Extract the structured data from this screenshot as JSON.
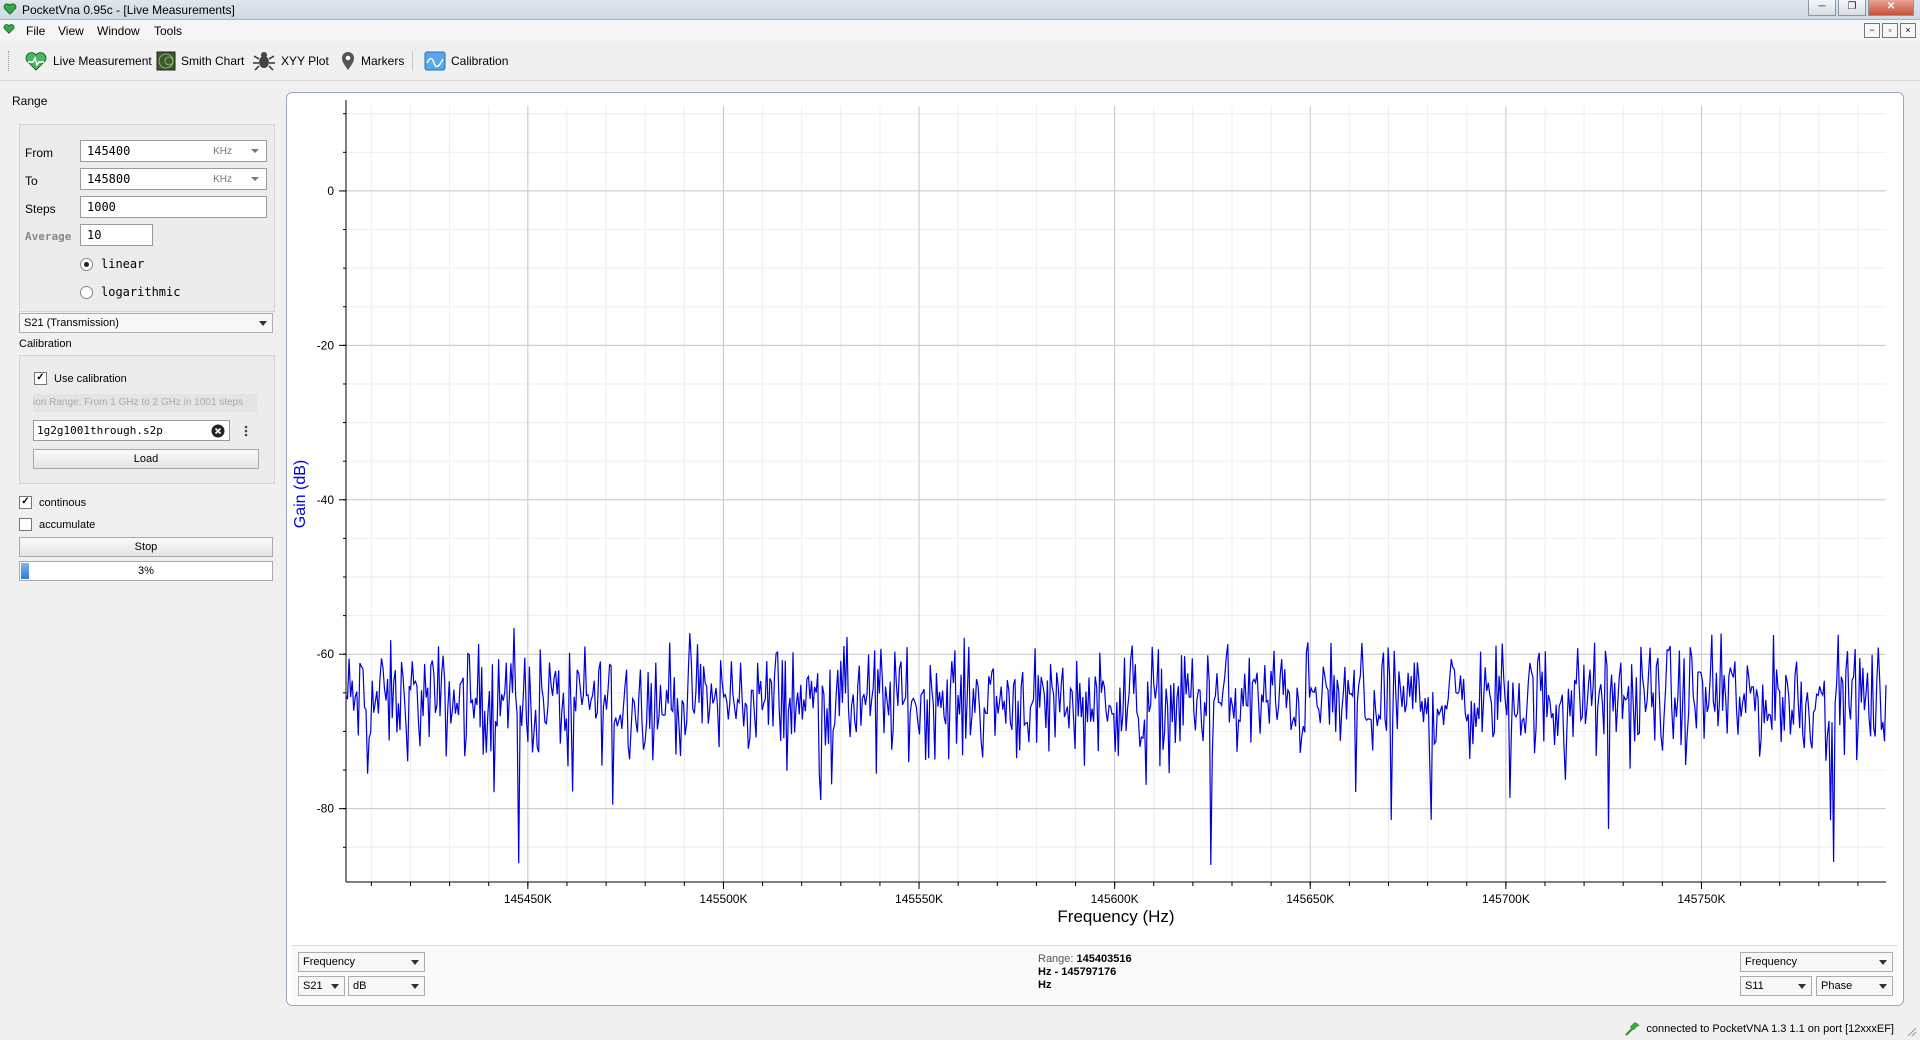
{
  "window": {
    "title": "PocketVna 0.95c - [Live Measurements]",
    "controls": [
      "─",
      "❐",
      "✕"
    ]
  },
  "menu": [
    "File",
    "View",
    "Window",
    "Tools"
  ],
  "mdi_controls": [
    "−",
    "▫",
    "×"
  ],
  "toolbar": [
    {
      "label": "Live Measurement",
      "icon": "heart-monitor-icon"
    },
    {
      "label": "Smith Chart",
      "icon": "smith-chart-icon"
    },
    {
      "label": "XYY Plot",
      "icon": "bug-plot-icon"
    },
    {
      "label": "Markers",
      "icon": "map-marker-icon"
    },
    {
      "label": "Calibration",
      "icon": "calibration-icon"
    }
  ],
  "range": {
    "title": "Range",
    "from_label": "From",
    "from_value": "145400",
    "from_unit": "KHz",
    "to_label": "To",
    "to_value": "145800",
    "to_unit": "KHz",
    "steps_label": "Steps",
    "steps_value": "1000",
    "average_label": "Average",
    "average_value": "10",
    "linear_label": "linear",
    "log_label": "logarithmic",
    "scale_selected": "linear"
  },
  "sparam_select": "S21 (Transmission)",
  "calibration": {
    "title": "Calibration",
    "use_label": "Use calibration",
    "use_checked": true,
    "range_info": "ion Range: From 1 GHz to 2 GHz in 1001 steps",
    "file": "1g2g1001through.s2p",
    "load_label": "Load"
  },
  "continuous": {
    "label": "continous",
    "checked": true
  },
  "accumulate": {
    "label": "accumulate",
    "checked": false
  },
  "stop_label": "Stop",
  "progress": {
    "percent": 3,
    "text": "3%"
  },
  "plot_bottom": {
    "left_axis_select": "Frequency",
    "left_param": "S21",
    "left_unit": "dB",
    "range_label": "Range:",
    "range_start": "145403516",
    "range_mid": "Hz - 145797176",
    "range_end": "Hz",
    "right_axis_select": "Frequency",
    "right_param": "S11",
    "right_unit": "Phase"
  },
  "status": {
    "text": "connected to PocketVNA 1.3 1.1 on port [12xxxEF]"
  },
  "chart_data": {
    "type": "line",
    "xlabel": "Frequency (Hz)",
    "ylabel": "Gain (dB)",
    "xlim": [
      145403516,
      145797176
    ],
    "ylim": [
      -89.5,
      11
    ],
    "x_ticks": [
      145450000,
      145500000,
      145550000,
      145600000,
      145650000,
      145700000,
      145750000
    ],
    "x_tick_labels": [
      "145450K",
      "145500K",
      "145550K",
      "145600K",
      "145650K",
      "145700K",
      "145750K"
    ],
    "y_ticks": [
      0,
      -20,
      -40,
      -60,
      -80
    ],
    "y_tick_labels": [
      "0",
      "-20",
      "-40",
      "-60",
      "-80"
    ],
    "grid": true,
    "series": [
      {
        "name": "S21",
        "color": "#0000dd",
        "points": 1000,
        "mean": -66,
        "noise_span": [
          -89,
          -56
        ]
      }
    ]
  }
}
